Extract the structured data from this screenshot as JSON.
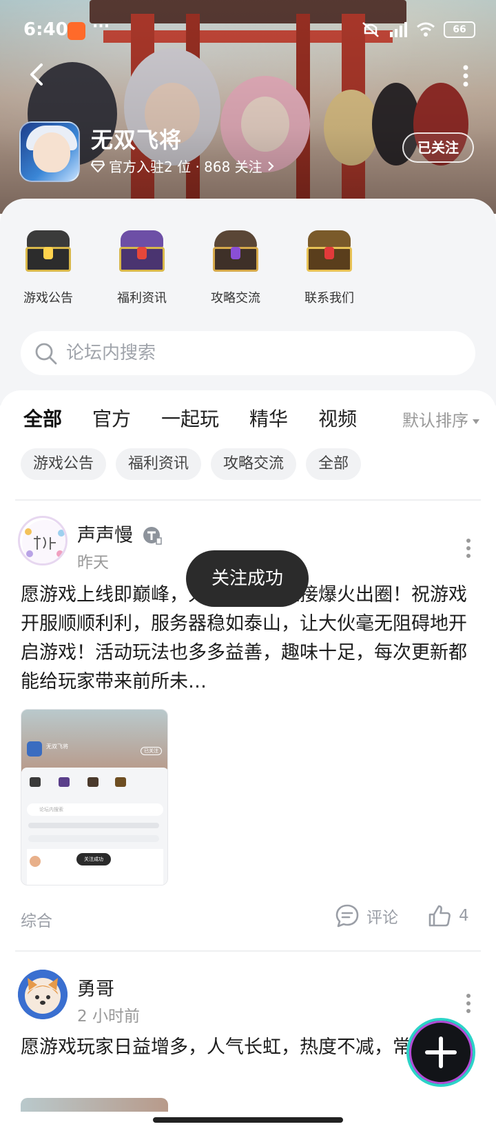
{
  "status_bar": {
    "time": "6:40",
    "dots": "···",
    "battery": "66"
  },
  "header": {
    "app_name": "无双飞将",
    "subtitle": "官方入驻2 位 · 868 关注",
    "follow_label": "已关注"
  },
  "quick_links": [
    {
      "label": "游戏公告"
    },
    {
      "label": "福利资讯"
    },
    {
      "label": "攻略交流"
    },
    {
      "label": "联系我们"
    }
  ],
  "search": {
    "placeholder": "论坛内搜索"
  },
  "tabs": [
    {
      "label": "全部"
    },
    {
      "label": "官方"
    },
    {
      "label": "一起玩"
    },
    {
      "label": "精华"
    },
    {
      "label": "视频"
    }
  ],
  "sort_label": "默认排序",
  "chips": [
    {
      "label": "游戏公告"
    },
    {
      "label": "福利资讯"
    },
    {
      "label": "攻略交流"
    },
    {
      "label": "全部"
    }
  ],
  "posts": [
    {
      "author": "声声慢",
      "time": "昨天",
      "body": "愿游戏上线即巅峰，大放光彩，直接爆火出圈！祝游戏开服顺顺利利，服务器稳如泰山，让大伙毫无阻碍地开启游戏！活动玩法也多多益善，趣味十足，每次更新都能给玩家带来前所未…",
      "category": "综合",
      "comment_label": "评论",
      "like_count": "4"
    },
    {
      "author": "勇哥",
      "time": "2 小时前",
      "body": "愿游戏玩家日益增多，人气长虹，热度不减，常在！"
    }
  ],
  "thumb": {
    "app_name": "无双飞将",
    "follow": "已关注",
    "search": "论坛内搜索",
    "toast": "关注成功"
  },
  "toast": "关注成功"
}
